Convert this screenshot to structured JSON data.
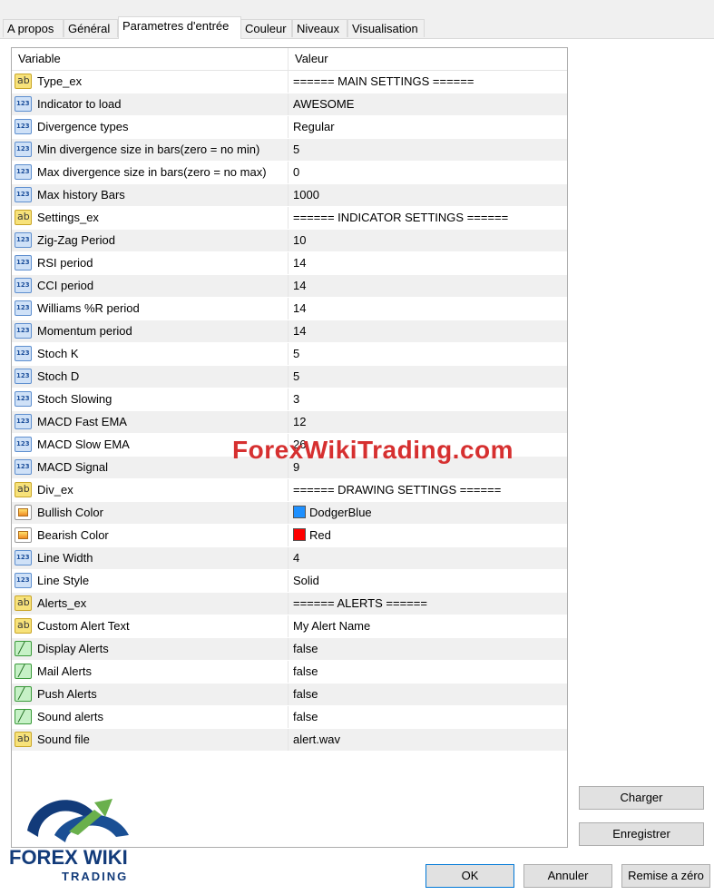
{
  "tabs": [
    {
      "label": "A propos"
    },
    {
      "label": "Général"
    },
    {
      "label": "Parametres d'entrée"
    },
    {
      "label": "Couleur"
    },
    {
      "label": "Niveaux"
    },
    {
      "label": "Visualisation"
    }
  ],
  "active_tab": "Parametres d'entrée",
  "grid": {
    "headers": {
      "variable": "Variable",
      "value": "Valeur"
    },
    "rows": [
      {
        "type": "ab",
        "variable": "Type_ex",
        "value": "====== MAIN SETTINGS ======"
      },
      {
        "type": "num",
        "variable": "Indicator to load",
        "value": "AWESOME"
      },
      {
        "type": "num",
        "variable": "Divergence types",
        "value": "Regular"
      },
      {
        "type": "num",
        "variable": "Min divergence size in bars(zero = no min)",
        "value": "5"
      },
      {
        "type": "num",
        "variable": "Max divergence size in bars(zero = no max)",
        "value": "0"
      },
      {
        "type": "num",
        "variable": "Max history Bars",
        "value": "1000"
      },
      {
        "type": "ab",
        "variable": "Settings_ex",
        "value": "====== INDICATOR SETTINGS ======"
      },
      {
        "type": "num",
        "variable": "Zig-Zag Period",
        "value": "10"
      },
      {
        "type": "num",
        "variable": "RSI period",
        "value": "14"
      },
      {
        "type": "num",
        "variable": "CCI period",
        "value": "14"
      },
      {
        "type": "num",
        "variable": "Williams %R period",
        "value": "14"
      },
      {
        "type": "num",
        "variable": "Momentum period",
        "value": "14"
      },
      {
        "type": "num",
        "variable": "Stoch K",
        "value": "5"
      },
      {
        "type": "num",
        "variable": "Stoch D",
        "value": "5"
      },
      {
        "type": "num",
        "variable": "Stoch Slowing",
        "value": "3"
      },
      {
        "type": "num",
        "variable": "MACD Fast EMA",
        "value": "12"
      },
      {
        "type": "num",
        "variable": "MACD Slow EMA",
        "value": "26"
      },
      {
        "type": "num",
        "variable": "MACD Signal",
        "value": "9"
      },
      {
        "type": "ab",
        "variable": "Div_ex",
        "value": "====== DRAWING SETTINGS ======"
      },
      {
        "type": "color",
        "variable": "Bullish Color",
        "value": "DodgerBlue",
        "swatch": "#1e90ff"
      },
      {
        "type": "color",
        "variable": "Bearish Color",
        "value": "Red",
        "swatch": "#ff0000"
      },
      {
        "type": "num",
        "variable": "Line Width",
        "value": "4"
      },
      {
        "type": "num",
        "variable": "Line Style",
        "value": "Solid"
      },
      {
        "type": "ab",
        "variable": "Alerts_ex",
        "value": "====== ALERTS ======"
      },
      {
        "type": "ab",
        "variable": "Custom Alert Text",
        "value": "My Alert Name"
      },
      {
        "type": "bool",
        "variable": "Display Alerts",
        "value": "false"
      },
      {
        "type": "bool",
        "variable": "Mail Alerts",
        "value": "false"
      },
      {
        "type": "bool",
        "variable": "Push Alerts",
        "value": "false"
      },
      {
        "type": "bool",
        "variable": "Sound alerts",
        "value": "false"
      },
      {
        "type": "ab",
        "variable": "Sound file",
        "value": "alert.wav"
      }
    ]
  },
  "buttons": {
    "load": "Charger",
    "save": "Enregistrer",
    "ok": "OK",
    "cancel": "Annuler",
    "reset": "Remise a zéro"
  },
  "watermark": "ForexWikiTrading.com",
  "logo": {
    "line1": "FOREX WIKI",
    "line2": "TRADING"
  }
}
